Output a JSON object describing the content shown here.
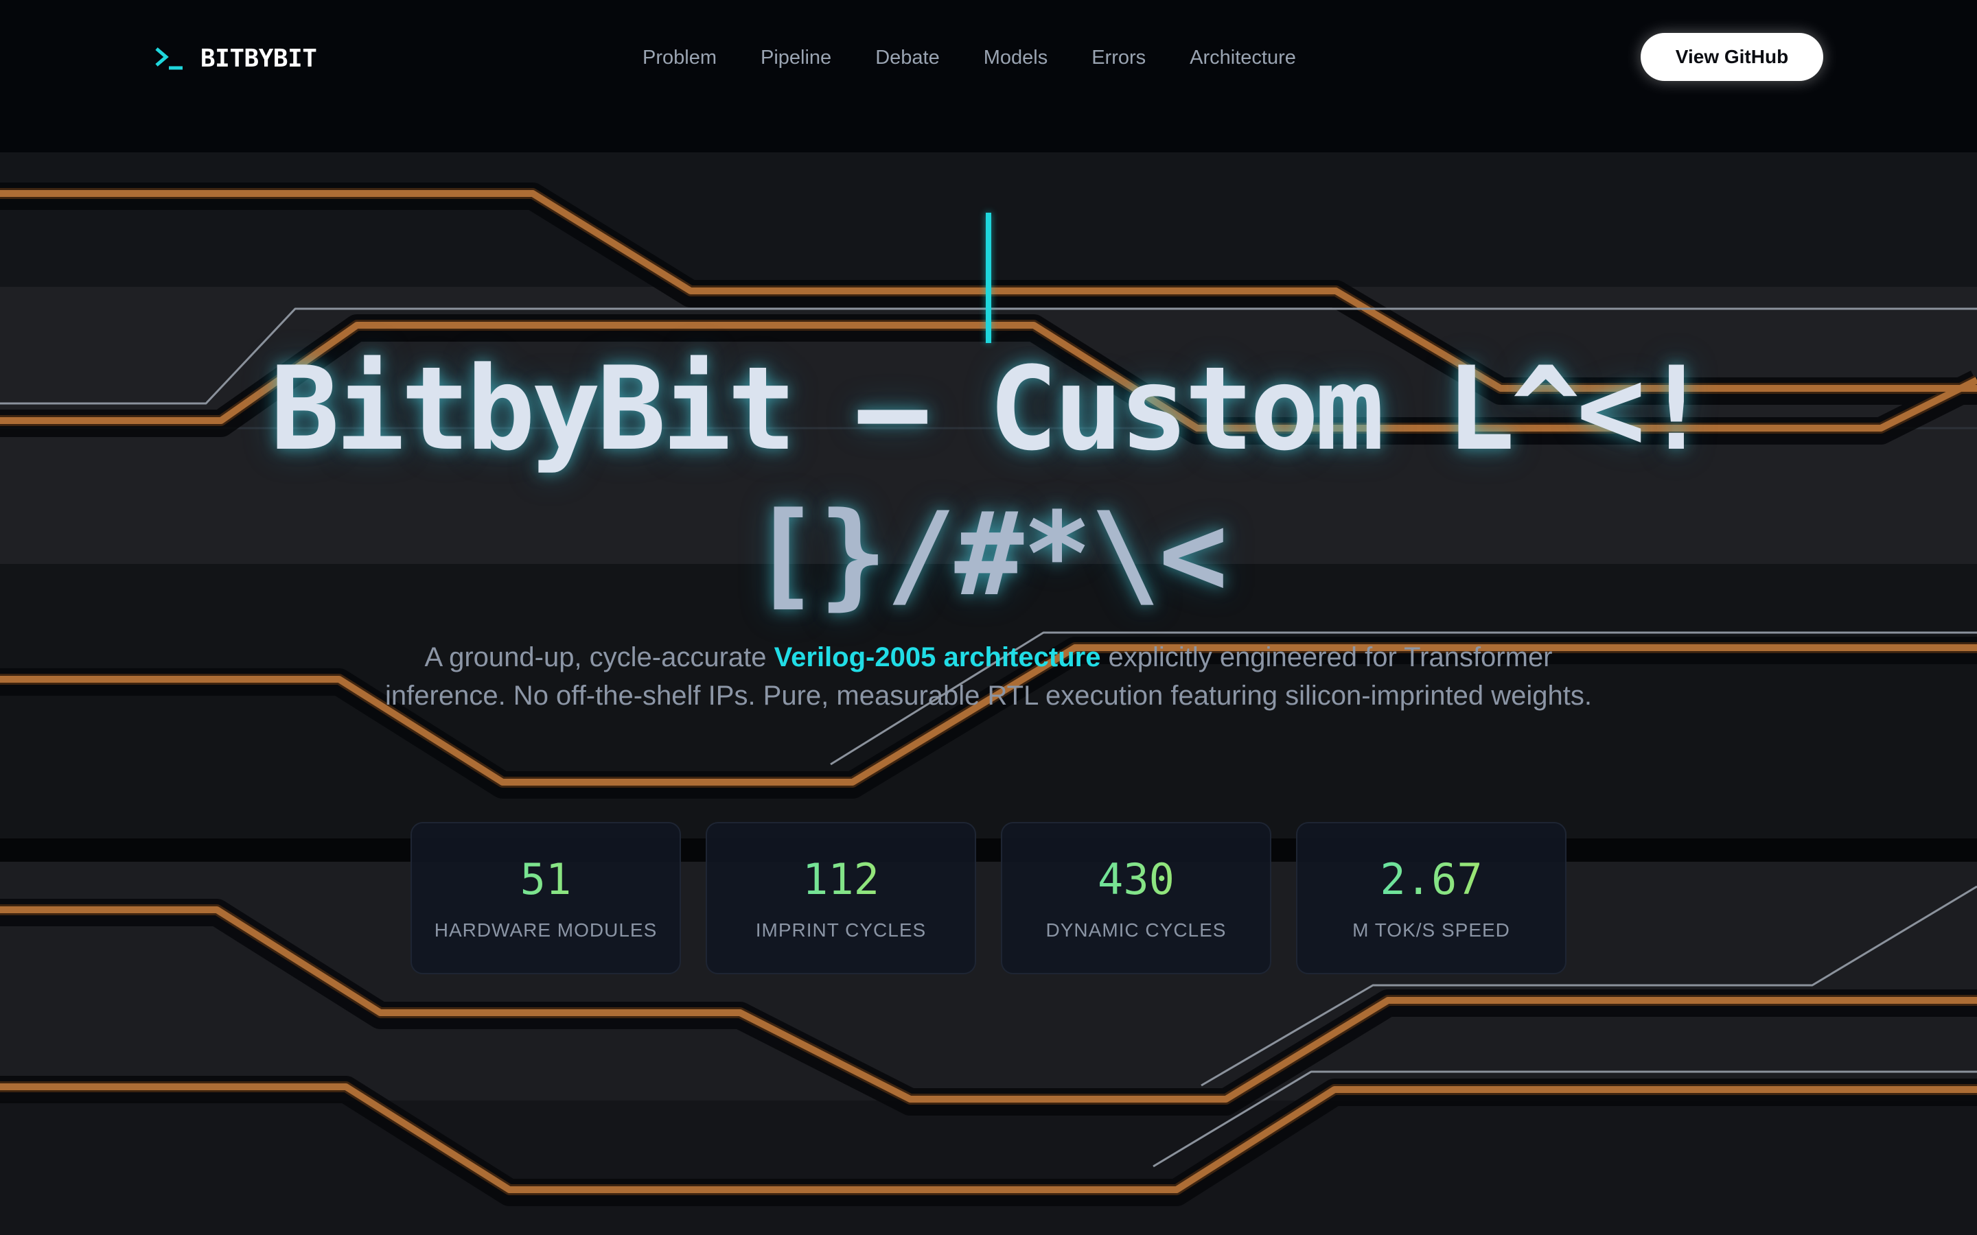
{
  "nav": {
    "brand": "BITBYBIT",
    "brand_icon": "terminal-prompt-icon",
    "links": [
      "Problem",
      "Pipeline",
      "Debate",
      "Models",
      "Errors",
      "Architecture"
    ],
    "cta": "View GitHub"
  },
  "hero": {
    "title_line1": "BitbyBit — Custom L^<!",
    "title_line2": "[}/#*\\<",
    "subtitle_pre": "A ground-up, cycle-accurate ",
    "subtitle_highlight": "Verilog-2005 architecture",
    "subtitle_post": " explicitly engineered for Transformer inference. No off-the-shelf IPs. Pure, measurable RTL execution featuring silicon-imprinted weights.",
    "stats": [
      {
        "value": "51",
        "label": "HARDWARE MODULES"
      },
      {
        "value": "112",
        "label": "IMPRINT CYCLES"
      },
      {
        "value": "430",
        "label": "DYNAMIC CYCLES"
      },
      {
        "value": "2.67",
        "label": "M TOK/S SPEED"
      }
    ]
  },
  "colors": {
    "accent": "#21dde6",
    "trace": "#b06f34",
    "background": "#05070b",
    "card": "#101622"
  }
}
